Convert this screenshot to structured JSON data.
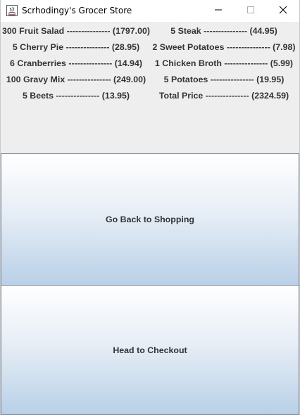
{
  "window": {
    "title": "Scrhodingy's Grocer Store",
    "app_icon": "java-app-icon",
    "controls": [
      "minimize-icon",
      "maximize-icon",
      "close-icon"
    ]
  },
  "items_left": [
    "300 Fruit Salad --------------- (1797.00)",
    "5 Cherry Pie --------------- (28.95)",
    "6 Cranberries --------------- (14.94)",
    "100 Gravy Mix --------------- (249.00)",
    "5 Beets --------------- (13.95)"
  ],
  "items_right": [
    "5 Steak --------------- (44.95)",
    "2 Sweet Potatoes --------------- (7.98)",
    "1 Chicken Broth --------------- (5.99)",
    "5 Potatoes --------------- (19.95)",
    "Total Price --------------- (2324.59)"
  ],
  "buttons": {
    "back": "Go Back to Shopping",
    "checkout": "Head to Checkout"
  }
}
